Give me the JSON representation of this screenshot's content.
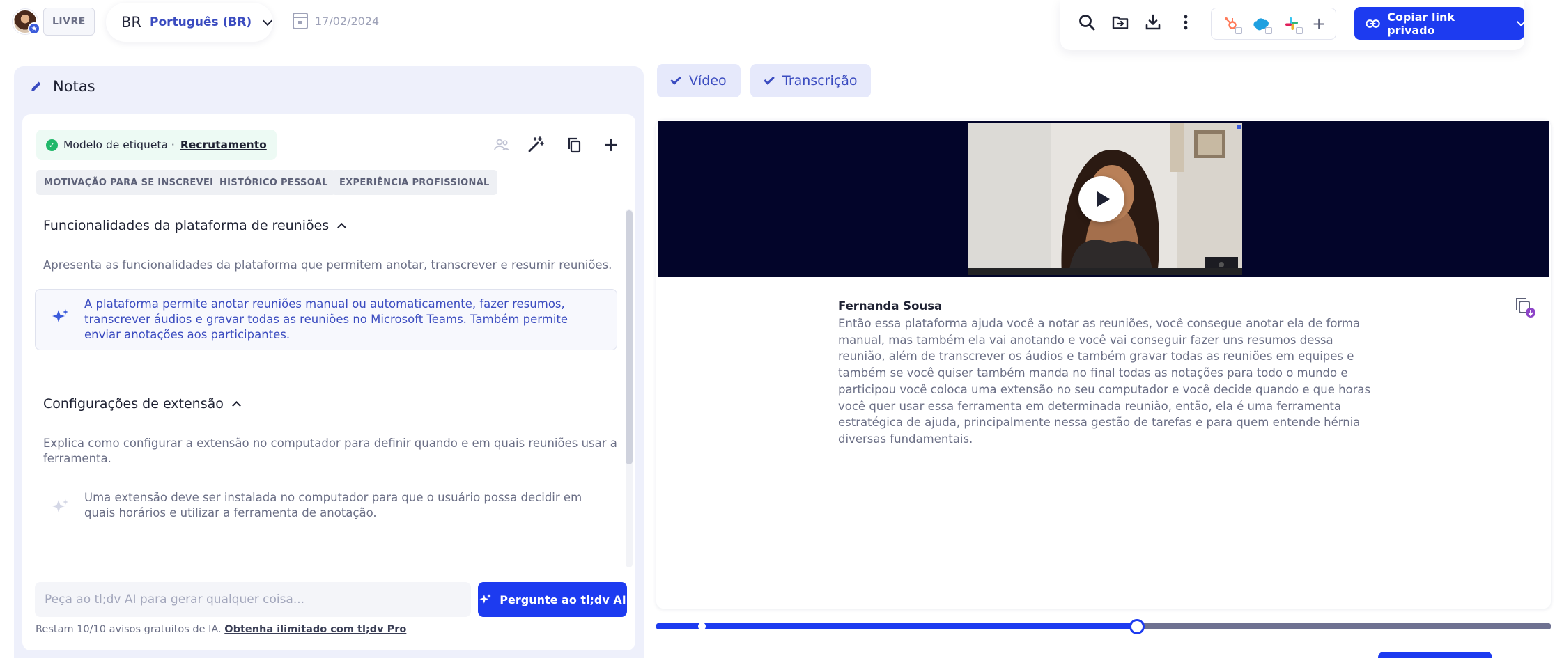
{
  "topbar": {
    "plan_label": "LIVRE",
    "language": {
      "code": "BR",
      "name": "Português (BR)"
    },
    "date": "17/02/2024",
    "copy_link_label": "Copiar link privado",
    "integrations": [
      "hubspot-icon",
      "salesforce-icon",
      "slack-icon"
    ],
    "add_integration_label": "+"
  },
  "notes": {
    "title": "Notas",
    "template": {
      "prefix": "Modelo de etiqueta ·",
      "name": "Recrutamento"
    },
    "tags": [
      "MOTIVAÇÃO PARA SE INSCREVER",
      "HISTÓRICO PESSOAL",
      "EXPERIÊNCIA PROFISSIONAL"
    ],
    "sections": [
      {
        "title": "Funcionalidades da plataforma de reuniões",
        "description": "Apresenta as funcionalidades da plataforma que permitem anotar, transcrever e resumir reuniões.",
        "ai_summary": "A plataforma permite anotar reuniões manual ou automaticamente, fazer resumos, transcrever áudios e gravar todas as reuniões no Microsoft Teams. Também permite enviar anotações aos participantes."
      },
      {
        "title": "Configurações de extensão",
        "description": "Explica como configurar a extensão no computador para definir quando e em quais reuniões usar a ferramenta.",
        "ai_summary": "Uma extensão deve ser instalada no computador para que o usuário possa decidir em quais horários e utilizar a ferramenta de anotação."
      }
    ],
    "ask": {
      "placeholder": "Peça ao tl;dv AI para gerar qualquer coisa...",
      "button_label": "Pergunte ao tl;dv AI"
    },
    "free_notice": "Restam 10/10 avisos gratuitos de IA.",
    "upgrade_link": "Obtenha ilimitado com tl;dv Pro"
  },
  "tabs": [
    {
      "label": "Vídeo"
    },
    {
      "label": "Transcrição"
    }
  ],
  "transcript": {
    "speaker": "Fernanda Sousa",
    "text": "Então essa plataforma ajuda você a notar as reuniões, você consegue anotar ela de forma manual, mas também ela vai anotando e você vai conseguir fazer uns resumos dessa reunião, além de transcrever os áudios e também gravar todas as reuniões em equipes e também se você quiser também manda no final todas as notações para todo o mundo e participou você coloca uma extensão no seu computador e você decide quando e que horas você quer usar essa ferramenta em determinada reunião, então, ela é uma ferramenta estratégica de ajuda, principalmente nessa gestão de tarefas e para quem entende hérnia diversas fundamentais."
  },
  "player": {
    "progress": 0.537
  },
  "colors": {
    "accent": "#1d3bf0",
    "video_bg": "#03052a",
    "panel_bg": "#eef0fb",
    "success": "#21b86a"
  }
}
